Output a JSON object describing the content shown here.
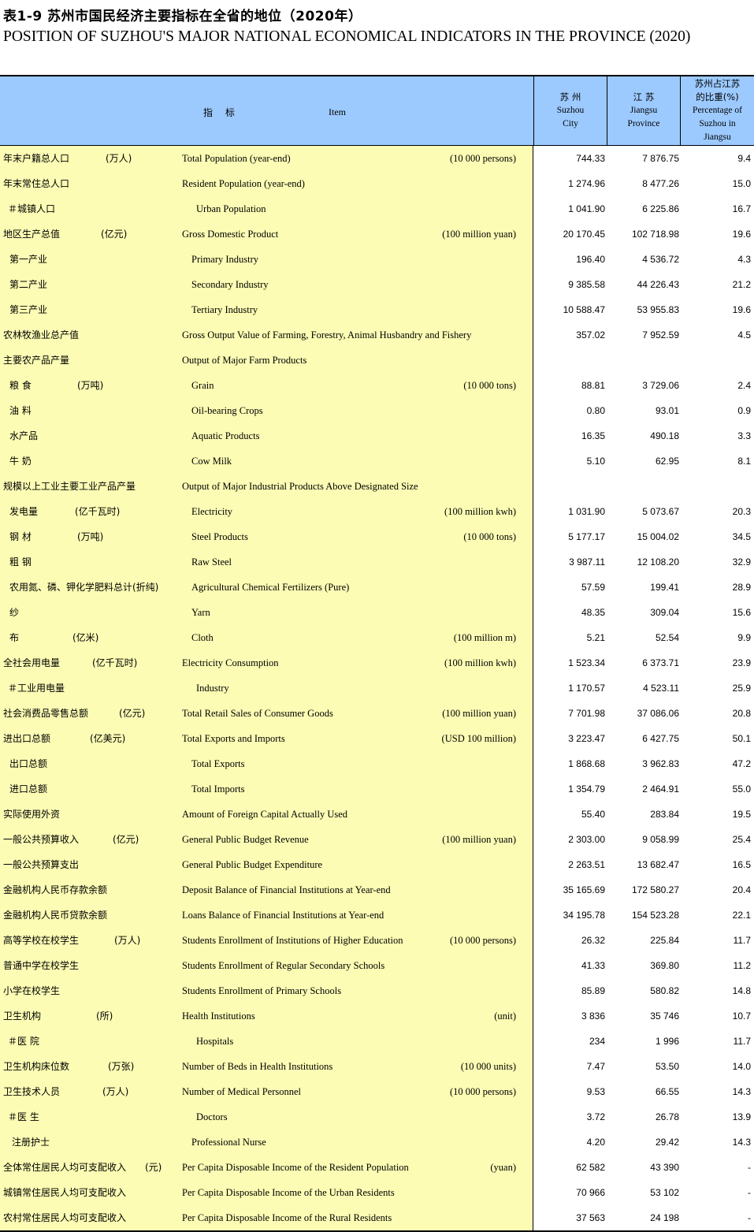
{
  "title_cn": "表1-9   苏州市国民经济主要指标在全省的地位（2020年）",
  "title_en": "POSITION OF SUZHOU'S MAJOR NATIONAL ECONOMICAL INDICATORS IN THE PROVINCE (2020)",
  "header": {
    "indicator_cn": "指 标",
    "item_en": "Item",
    "suzhou": [
      "苏 州",
      "Suzhou",
      "City"
    ],
    "jiangsu": [
      "江 苏",
      "Jiangsu",
      "Province"
    ],
    "share": [
      "苏州占江苏",
      "的比重(%)",
      "Percentage of",
      "Suzhou in",
      "Jiangsu"
    ]
  },
  "rows": [
    {
      "cn": "年末户籍总人口",
      "cn_unit": "(万人)",
      "en": "Total Population (year-end)",
      "en_unit": "(10 000 persons)",
      "suzhou": "744.33",
      "jiangsu": "7 876.75",
      "share": "9.4",
      "indent": 0
    },
    {
      "cn": "年末常住总人口",
      "cn_unit": "",
      "en": "Resident Population (year-end)",
      "en_unit": "",
      "suzhou": "1 274.96",
      "jiangsu": "8 477.26",
      "share": "15.0",
      "indent": 0
    },
    {
      "cn": "＃城镇人口",
      "cn_unit": "",
      "en": "Urban Population",
      "en_unit": "",
      "suzhou": "1 041.90",
      "jiangsu": "6 225.86",
      "share": "16.7",
      "indent": 2
    },
    {
      "cn": "地区生产总值",
      "cn_unit": "(亿元)",
      "en": "Gross Domestic Product",
      "en_unit": "(100 million yuan)",
      "suzhou": "20 170.45",
      "jiangsu": "102 718.98",
      "share": "19.6",
      "indent": 0
    },
    {
      "cn": "第一产业",
      "cn_unit": "",
      "en": "Primary Industry",
      "en_unit": "",
      "suzhou": "196.40",
      "jiangsu": "4 536.72",
      "share": "4.3",
      "indent": 1
    },
    {
      "cn": "第二产业",
      "cn_unit": "",
      "en": "Secondary Industry",
      "en_unit": "",
      "suzhou": "9 385.58",
      "jiangsu": "44 226.43",
      "share": "21.2",
      "indent": 1
    },
    {
      "cn": "第三产业",
      "cn_unit": "",
      "en": "Tertiary Industry",
      "en_unit": "",
      "suzhou": "10 588.47",
      "jiangsu": "53 955.83",
      "share": "19.6",
      "indent": 1
    },
    {
      "cn": "农林牧渔业总产值",
      "cn_unit": "",
      "en": "Gross Output Value of Farming, Forestry, Animal Husbandry and Fishery",
      "en_unit": "",
      "suzhou": "357.02",
      "jiangsu": "7 952.59",
      "share": "4.5",
      "indent": 0
    },
    {
      "cn": "主要农产品产量",
      "cn_unit": "",
      "en": "Output of Major Farm Products",
      "en_unit": "",
      "suzhou": "",
      "jiangsu": "",
      "share": "",
      "indent": 0
    },
    {
      "cn": "粮 食",
      "cn_unit": "(万吨)",
      "en": "Grain",
      "en_unit": "(10 000 tons)",
      "suzhou": "88.81",
      "jiangsu": "3 729.06",
      "share": "2.4",
      "indent": 1
    },
    {
      "cn": "油 料",
      "cn_unit": "",
      "en": "Oil-bearing Crops",
      "en_unit": "",
      "suzhou": "0.80",
      "jiangsu": "93.01",
      "share": "0.9",
      "indent": 1
    },
    {
      "cn": "水产品",
      "cn_unit": "",
      "en": "Aquatic Products",
      "en_unit": "",
      "suzhou": "16.35",
      "jiangsu": "490.18",
      "share": "3.3",
      "indent": 1
    },
    {
      "cn": "牛 奶",
      "cn_unit": "",
      "en": "Cow Milk",
      "en_unit": "",
      "suzhou": "5.10",
      "jiangsu": "62.95",
      "share": "8.1",
      "indent": 1
    },
    {
      "cn": "规模以上工业主要工业产品产量",
      "cn_unit": "",
      "en": "Output of Major Industrial Products Above Designated Size",
      "en_unit": "",
      "suzhou": "",
      "jiangsu": "",
      "share": "",
      "indent": 0
    },
    {
      "cn": "发电量",
      "cn_unit": "(亿千瓦时)",
      "en": "Electricity",
      "en_unit": "(100 million kwh)",
      "suzhou": "1 031.90",
      "jiangsu": "5 073.67",
      "share": "20.3",
      "indent": 1
    },
    {
      "cn": "钢 材",
      "cn_unit": "(万吨)",
      "en": "Steel Products",
      "en_unit": "(10 000 tons)",
      "suzhou": "5 177.17",
      "jiangsu": "15 004.02",
      "share": "34.5",
      "indent": 1
    },
    {
      "cn": "粗 钢",
      "cn_unit": "",
      "en": "Raw Steel",
      "en_unit": "",
      "suzhou": "3 987.11",
      "jiangsu": "12 108.20",
      "share": "32.9",
      "indent": 1
    },
    {
      "cn": "农用氮、磷、钾化学肥料总计(折纯)",
      "cn_unit": "",
      "en": "Agricultural Chemical Fertilizers (Pure)",
      "en_unit": "",
      "suzhou": "57.59",
      "jiangsu": "199.41",
      "share": "28.9",
      "indent": 1
    },
    {
      "cn": "纱",
      "cn_unit": "",
      "en": "Yarn",
      "en_unit": "",
      "suzhou": "48.35",
      "jiangsu": "309.04",
      "share": "15.6",
      "indent": 1
    },
    {
      "cn": "布",
      "cn_unit": "(亿米)",
      "en": "Cloth",
      "en_unit": "(100 million m)",
      "suzhou": "5.21",
      "jiangsu": "52.54",
      "share": "9.9",
      "indent": 1
    },
    {
      "cn": "全社会用电量",
      "cn_unit": "(亿千瓦时)",
      "en": "Electricity Consumption",
      "en_unit": "(100 million kwh)",
      "suzhou": "1 523.34",
      "jiangsu": "6 373.71",
      "share": "23.9",
      "indent": 0
    },
    {
      "cn": "＃工业用电量",
      "cn_unit": "",
      "en": "Industry",
      "en_unit": "",
      "suzhou": "1 170.57",
      "jiangsu": "4 523.11",
      "share": "25.9",
      "indent": 2
    },
    {
      "cn": "社会消费品零售总额",
      "cn_unit": "(亿元)",
      "en": "Total Retail Sales of Consumer Goods",
      "en_unit": "(100 million yuan)",
      "suzhou": "7 701.98",
      "jiangsu": "37 086.06",
      "share": "20.8",
      "indent": 0
    },
    {
      "cn": "进出口总额",
      "cn_unit": "(亿美元)",
      "en": "Total Exports and Imports",
      "en_unit": "(USD 100 million)",
      "suzhou": "3 223.47",
      "jiangsu": "6 427.75",
      "share": "50.1",
      "indent": 0
    },
    {
      "cn": "出口总额",
      "cn_unit": "",
      "en": "Total Exports",
      "en_unit": "",
      "suzhou": "1 868.68",
      "jiangsu": "3 962.83",
      "share": "47.2",
      "indent": 1
    },
    {
      "cn": "进口总额",
      "cn_unit": "",
      "en": "Total Imports",
      "en_unit": "",
      "suzhou": "1 354.79",
      "jiangsu": "2 464.91",
      "share": "55.0",
      "indent": 1
    },
    {
      "cn": "实际使用外资",
      "cn_unit": "",
      "en": "Amount of Foreign Capital Actually Used",
      "en_unit": "",
      "suzhou": "55.40",
      "jiangsu": "283.84",
      "share": "19.5",
      "indent": 0
    },
    {
      "cn": "一般公共预算收入",
      "cn_unit": "(亿元)",
      "en": "General Public Budget Revenue",
      "en_unit": "(100 million yuan)",
      "suzhou": "2 303.00",
      "jiangsu": "9 058.99",
      "share": "25.4",
      "indent": 0
    },
    {
      "cn": "一般公共预算支出",
      "cn_unit": "",
      "en": "General Public Budget Expenditure",
      "en_unit": "",
      "suzhou": "2 263.51",
      "jiangsu": "13 682.47",
      "share": "16.5",
      "indent": 0
    },
    {
      "cn": "金融机构人民币存款余额",
      "cn_unit": "",
      "en": "Deposit Balance of Financial Institutions at Year-end",
      "en_unit": "",
      "suzhou": "35 165.69",
      "jiangsu": "172 580.27",
      "share": "20.4",
      "indent": 0
    },
    {
      "cn": "金融机构人民币贷款余额",
      "cn_unit": "",
      "en": "Loans Balance of Financial Institutions at Year-end",
      "en_unit": "",
      "suzhou": "34 195.78",
      "jiangsu": "154 523.28",
      "share": "22.1",
      "indent": 0
    },
    {
      "cn": "高等学校在校学生",
      "cn_unit": "(万人)",
      "en": "Students Enrollment of Institutions of Higher Education",
      "en_unit": "(10 000 persons)",
      "suzhou": "26.32",
      "jiangsu": "225.84",
      "share": "11.7",
      "indent": 0
    },
    {
      "cn": "普通中学在校学生",
      "cn_unit": "",
      "en": "Students Enrollment of Regular Secondary Schools",
      "en_unit": "",
      "suzhou": "41.33",
      "jiangsu": "369.80",
      "share": "11.2",
      "indent": 0
    },
    {
      "cn": "小学在校学生",
      "cn_unit": "",
      "en": "Students Enrollment of Primary Schools",
      "en_unit": "",
      "suzhou": "85.89",
      "jiangsu": "580.82",
      "share": "14.8",
      "indent": 0
    },
    {
      "cn": "卫生机构",
      "cn_unit": "(所)",
      "en": "Health Institutions",
      "en_unit": "(unit)",
      "suzhou": "3 836",
      "jiangsu": "35 746",
      "share": "10.7",
      "indent": 0
    },
    {
      "cn": "＃医 院",
      "cn_unit": "",
      "en": "Hospitals",
      "en_unit": "",
      "suzhou": "234",
      "jiangsu": "1 996",
      "share": "11.7",
      "indent": 2
    },
    {
      "cn": "卫生机构床位数",
      "cn_unit": "(万张)",
      "en": "Number of Beds in Health Institutions",
      "en_unit": "(10 000 units)",
      "suzhou": "7.47",
      "jiangsu": "53.50",
      "share": "14.0",
      "indent": 0
    },
    {
      "cn": "卫生技术人员",
      "cn_unit": "(万人)",
      "en": "Number of Medical Personnel",
      "en_unit": "(10 000 persons)",
      "suzhou": "9.53",
      "jiangsu": "66.55",
      "share": "14.3",
      "indent": 0
    },
    {
      "cn": "＃医 生",
      "cn_unit": "",
      "en": "Doctors",
      "en_unit": "",
      "suzhou": "3.72",
      "jiangsu": "26.78",
      "share": "13.9",
      "indent": 2
    },
    {
      "cn": "注册护士",
      "cn_unit": "",
      "en": "Professional Nurse",
      "en_unit": "",
      "suzhou": "4.20",
      "jiangsu": "29.42",
      "share": "14.3",
      "indent": 3
    },
    {
      "cn": "全体常住居民人均可支配收入",
      "cn_unit": "(元)",
      "en": "Per Capita Disposable Income of the Resident  Population",
      "en_unit": "(yuan)",
      "suzhou": "62 582",
      "jiangsu": "43 390",
      "share": "-",
      "indent": 0
    },
    {
      "cn": "城镇常住居民人均可支配收入",
      "cn_unit": "",
      "en": "Per Capita Disposable Income of the Urban Residents",
      "en_unit": "",
      "suzhou": "70 966",
      "jiangsu": "53 102",
      "share": "-",
      "indent": 0
    },
    {
      "cn": "农村常住居民人均可支配收入",
      "cn_unit": "",
      "en": "Per Capita Disposable Income of the Rural Residents",
      "en_unit": "",
      "suzhou": "37 563",
      "jiangsu": "24 198",
      "share": "-",
      "indent": 0
    }
  ]
}
